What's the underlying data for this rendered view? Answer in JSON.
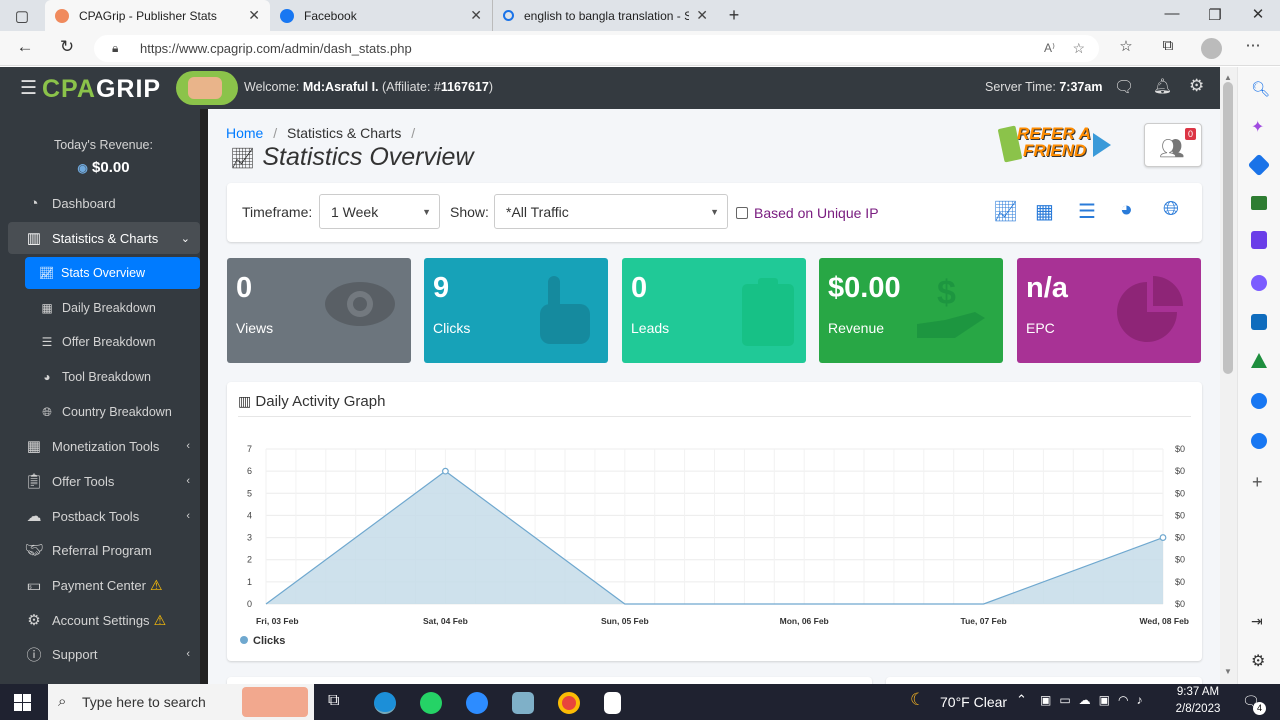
{
  "browser": {
    "tabs": [
      {
        "title": "CPAGrip - Publisher Stats"
      },
      {
        "title": "Facebook"
      },
      {
        "title": "english to bangla translation - Se"
      }
    ],
    "url": "https://www.cpagrip.com/admin/dash_stats.php"
  },
  "header": {
    "logo": "CPAGRIP",
    "welcome_prefix": "Welcome:",
    "user_name": "Md:Asraful I.",
    "affiliate_prefix": "(Affiliate: #",
    "affiliate_id": "1167617",
    "affiliate_suffix": ")",
    "server_time_label": "Server Time:",
    "server_time": "7:37am"
  },
  "sidebar": {
    "revenue_label": "Today's Revenue:",
    "revenue_value": "$0.00",
    "items": [
      {
        "label": "Dashboard"
      },
      {
        "label": "Statistics & Charts"
      },
      {
        "label": "Stats Overview"
      },
      {
        "label": "Daily Breakdown"
      },
      {
        "label": "Offer Breakdown"
      },
      {
        "label": "Tool Breakdown"
      },
      {
        "label": "Country Breakdown"
      },
      {
        "label": "Monetization Tools"
      },
      {
        "label": "Offer Tools"
      },
      {
        "label": "Postback Tools"
      },
      {
        "label": "Referral Program"
      },
      {
        "label": "Payment Center"
      },
      {
        "label": "Account Settings"
      },
      {
        "label": "Support"
      }
    ]
  },
  "breadcrumb": {
    "home": "Home",
    "current": "Statistics & Charts"
  },
  "page_title": "Statistics Overview",
  "refer": {
    "line1": "REFER A",
    "line2": "FRIEND",
    "badge": "0"
  },
  "filters": {
    "timeframe_label": "Timeframe:",
    "timeframe_value": "1 Week",
    "show_label": "Show:",
    "show_value": "*All Traffic",
    "unique_ip_label": "Based on Unique IP",
    "unique_ip_checked": false
  },
  "stats": [
    {
      "value": "0",
      "label": "Views",
      "color": "#6c757d"
    },
    {
      "value": "9",
      "label": "Clicks",
      "color": "#17a2b8"
    },
    {
      "value": "0",
      "label": "Leads",
      "color": "#20c997"
    },
    {
      "value": "$0.00",
      "label": "Revenue",
      "color": "#28a745"
    },
    {
      "value": "n/a",
      "label": "EPC",
      "color": "#a83295"
    }
  ],
  "graph_title": "Daily Activity Graph",
  "chart_data": {
    "type": "area",
    "x": [
      "Fri, 03 Feb",
      "Sat, 04 Feb",
      "Sun, 05 Feb",
      "Mon, 06 Feb",
      "Tue, 07 Feb",
      "Wed, 08 Feb"
    ],
    "series": [
      {
        "name": "Clicks",
        "values": [
          0,
          6,
          0,
          0,
          0,
          3
        ]
      }
    ],
    "ylim": [
      0,
      7
    ],
    "yticks": [
      "0",
      "1",
      "2",
      "3",
      "4",
      "5",
      "6",
      "7"
    ],
    "y2ticks": [
      "$0",
      "$0",
      "$0",
      "$0",
      "$0",
      "$0",
      "$0",
      "$0"
    ],
    "grid": true,
    "legend": "bottom-left",
    "colors": {
      "fill": "#c5dce9",
      "line": "#6fa8cf"
    }
  },
  "taskbar": {
    "search_placeholder": "Type here to search",
    "weather": "70°F  Clear",
    "time": "9:37 AM",
    "date": "2/8/2023",
    "notif_count": "4"
  }
}
